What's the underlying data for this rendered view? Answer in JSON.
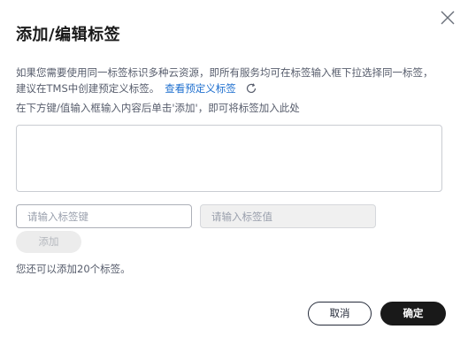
{
  "dialog": {
    "title": "添加/编辑标签",
    "close_icon": "close-icon",
    "description": "如果您需要使用同一标签标识多种云资源，即所有服务均可在标签输入框下拉选择同一标签，建议在TMS中创建预定义标签。",
    "predefined_link": "查看预定义标签",
    "refresh_icon": "refresh-icon",
    "hint": "在下方键/值输入框输入内容后单击'添加'，即可将标签加入此处",
    "key_placeholder": "请输入标签键",
    "value_placeholder": "请输入标签值",
    "add_label": "添加",
    "remaining_text": "您还可以添加20个标签。",
    "cancel_label": "取消",
    "confirm_label": "确定"
  }
}
